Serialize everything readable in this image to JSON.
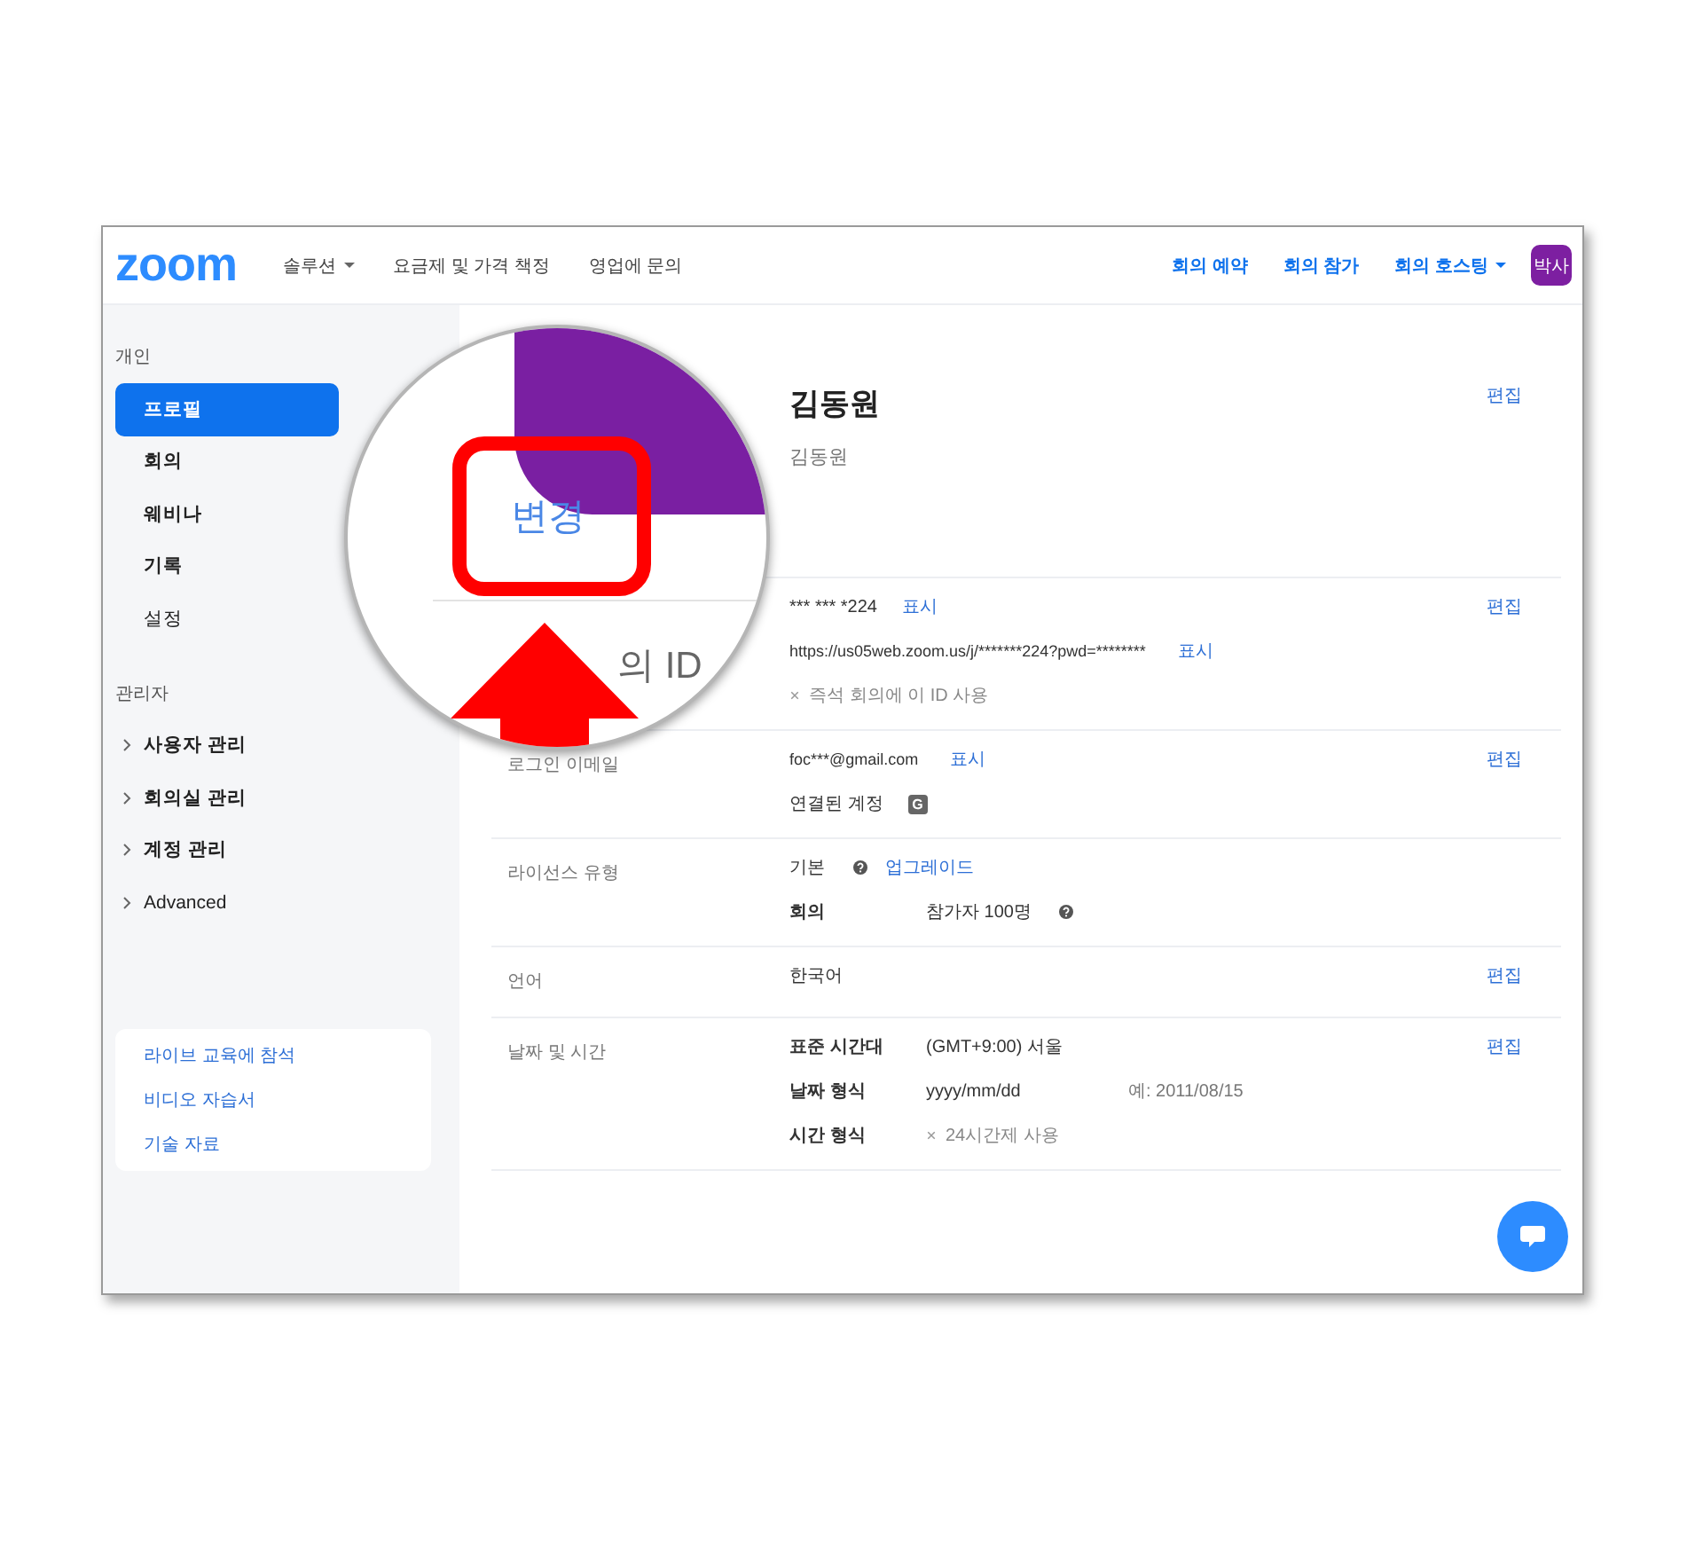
{
  "header": {
    "logo": "zoom",
    "nav": [
      {
        "label": "솔루션",
        "dropdown": true
      },
      {
        "label": "요금제 및 가격 책정",
        "dropdown": false
      },
      {
        "label": "영업에 문의",
        "dropdown": false
      }
    ],
    "right_nav": [
      {
        "label": "회의 예약",
        "dropdown": false
      },
      {
        "label": "회의 참가",
        "dropdown": false
      },
      {
        "label": "회의 호스팅",
        "dropdown": true
      }
    ],
    "avatar": "박사"
  },
  "sidebar": {
    "sections": [
      {
        "title": "개인",
        "items": [
          {
            "label": "프로필",
            "selected": true,
            "expandable": false
          },
          {
            "label": "회의",
            "selected": false,
            "expandable": false
          },
          {
            "label": "웨비나",
            "selected": false,
            "expandable": false
          },
          {
            "label": "기록",
            "selected": false,
            "expandable": false
          },
          {
            "label": "설정",
            "selected": false,
            "expandable": false
          }
        ]
      },
      {
        "title": "관리자",
        "items": [
          {
            "label": "사용자 관리",
            "selected": false,
            "expandable": true
          },
          {
            "label": "회의실 관리",
            "selected": false,
            "expandable": true
          },
          {
            "label": "계정 관리",
            "selected": false,
            "expandable": true
          },
          {
            "label": "Advanced",
            "selected": false,
            "expandable": true
          }
        ]
      }
    ],
    "links": [
      "라이브 교육에 참석",
      "비디오 자습서",
      "기술 자료"
    ]
  },
  "profile": {
    "name": "김동원",
    "subname": "김동원",
    "edit": "편집"
  },
  "magnifier": {
    "change_link": "변경",
    "id_label": "의 ID"
  },
  "rows": [
    {
      "edit": "편집",
      "lines": [
        [
          {
            "kind": "text",
            "text": "*** *** *224"
          },
          {
            "kind": "link",
            "text": "표시"
          }
        ],
        [
          {
            "kind": "small",
            "text": "https://us05web.zoom.us/j/*******224?pwd=********"
          },
          {
            "kind": "link",
            "text": "표시"
          }
        ],
        [
          {
            "kind": "option",
            "on": false,
            "text": "즉석 회의에 이 ID 사용"
          }
        ]
      ]
    },
    {
      "label": "로그인 이메일",
      "edit": "편집",
      "lines": [
        [
          {
            "kind": "small",
            "text": "foc***@gmail.com"
          },
          {
            "kind": "link",
            "text": "표시"
          }
        ],
        [
          {
            "kind": "text",
            "text": "연결된 계정"
          },
          {
            "kind": "google",
            "text": "G"
          }
        ]
      ]
    },
    {
      "label": "라이선스 유형",
      "lines": [
        [
          {
            "kind": "text",
            "text": "기본",
            "help": true
          },
          {
            "kind": "link",
            "text": "업그레이드"
          }
        ],
        [
          {
            "kind": "key",
            "text": "회의"
          },
          {
            "kind": "text",
            "text": "참가자 100명",
            "help": true
          }
        ]
      ]
    },
    {
      "label": "언어",
      "edit": "편집",
      "lines": [
        [
          {
            "kind": "text",
            "text": "한국어"
          }
        ]
      ]
    },
    {
      "label": "날짜 및 시간",
      "edit": "편집",
      "lines": [
        [
          {
            "kind": "key",
            "text": "표준 시간대"
          },
          {
            "kind": "text",
            "text": "(GMT+9:00) 서울"
          }
        ],
        [
          {
            "kind": "key",
            "text": "날짜 형식"
          },
          {
            "kind": "wide",
            "text": "yyyy/mm/dd"
          },
          {
            "kind": "muted",
            "text": "예: 2011/08/15"
          }
        ],
        [
          {
            "kind": "key",
            "text": "시간 형식"
          },
          {
            "kind": "option",
            "on": false,
            "text": "24시간제 사용"
          }
        ]
      ]
    }
  ]
}
